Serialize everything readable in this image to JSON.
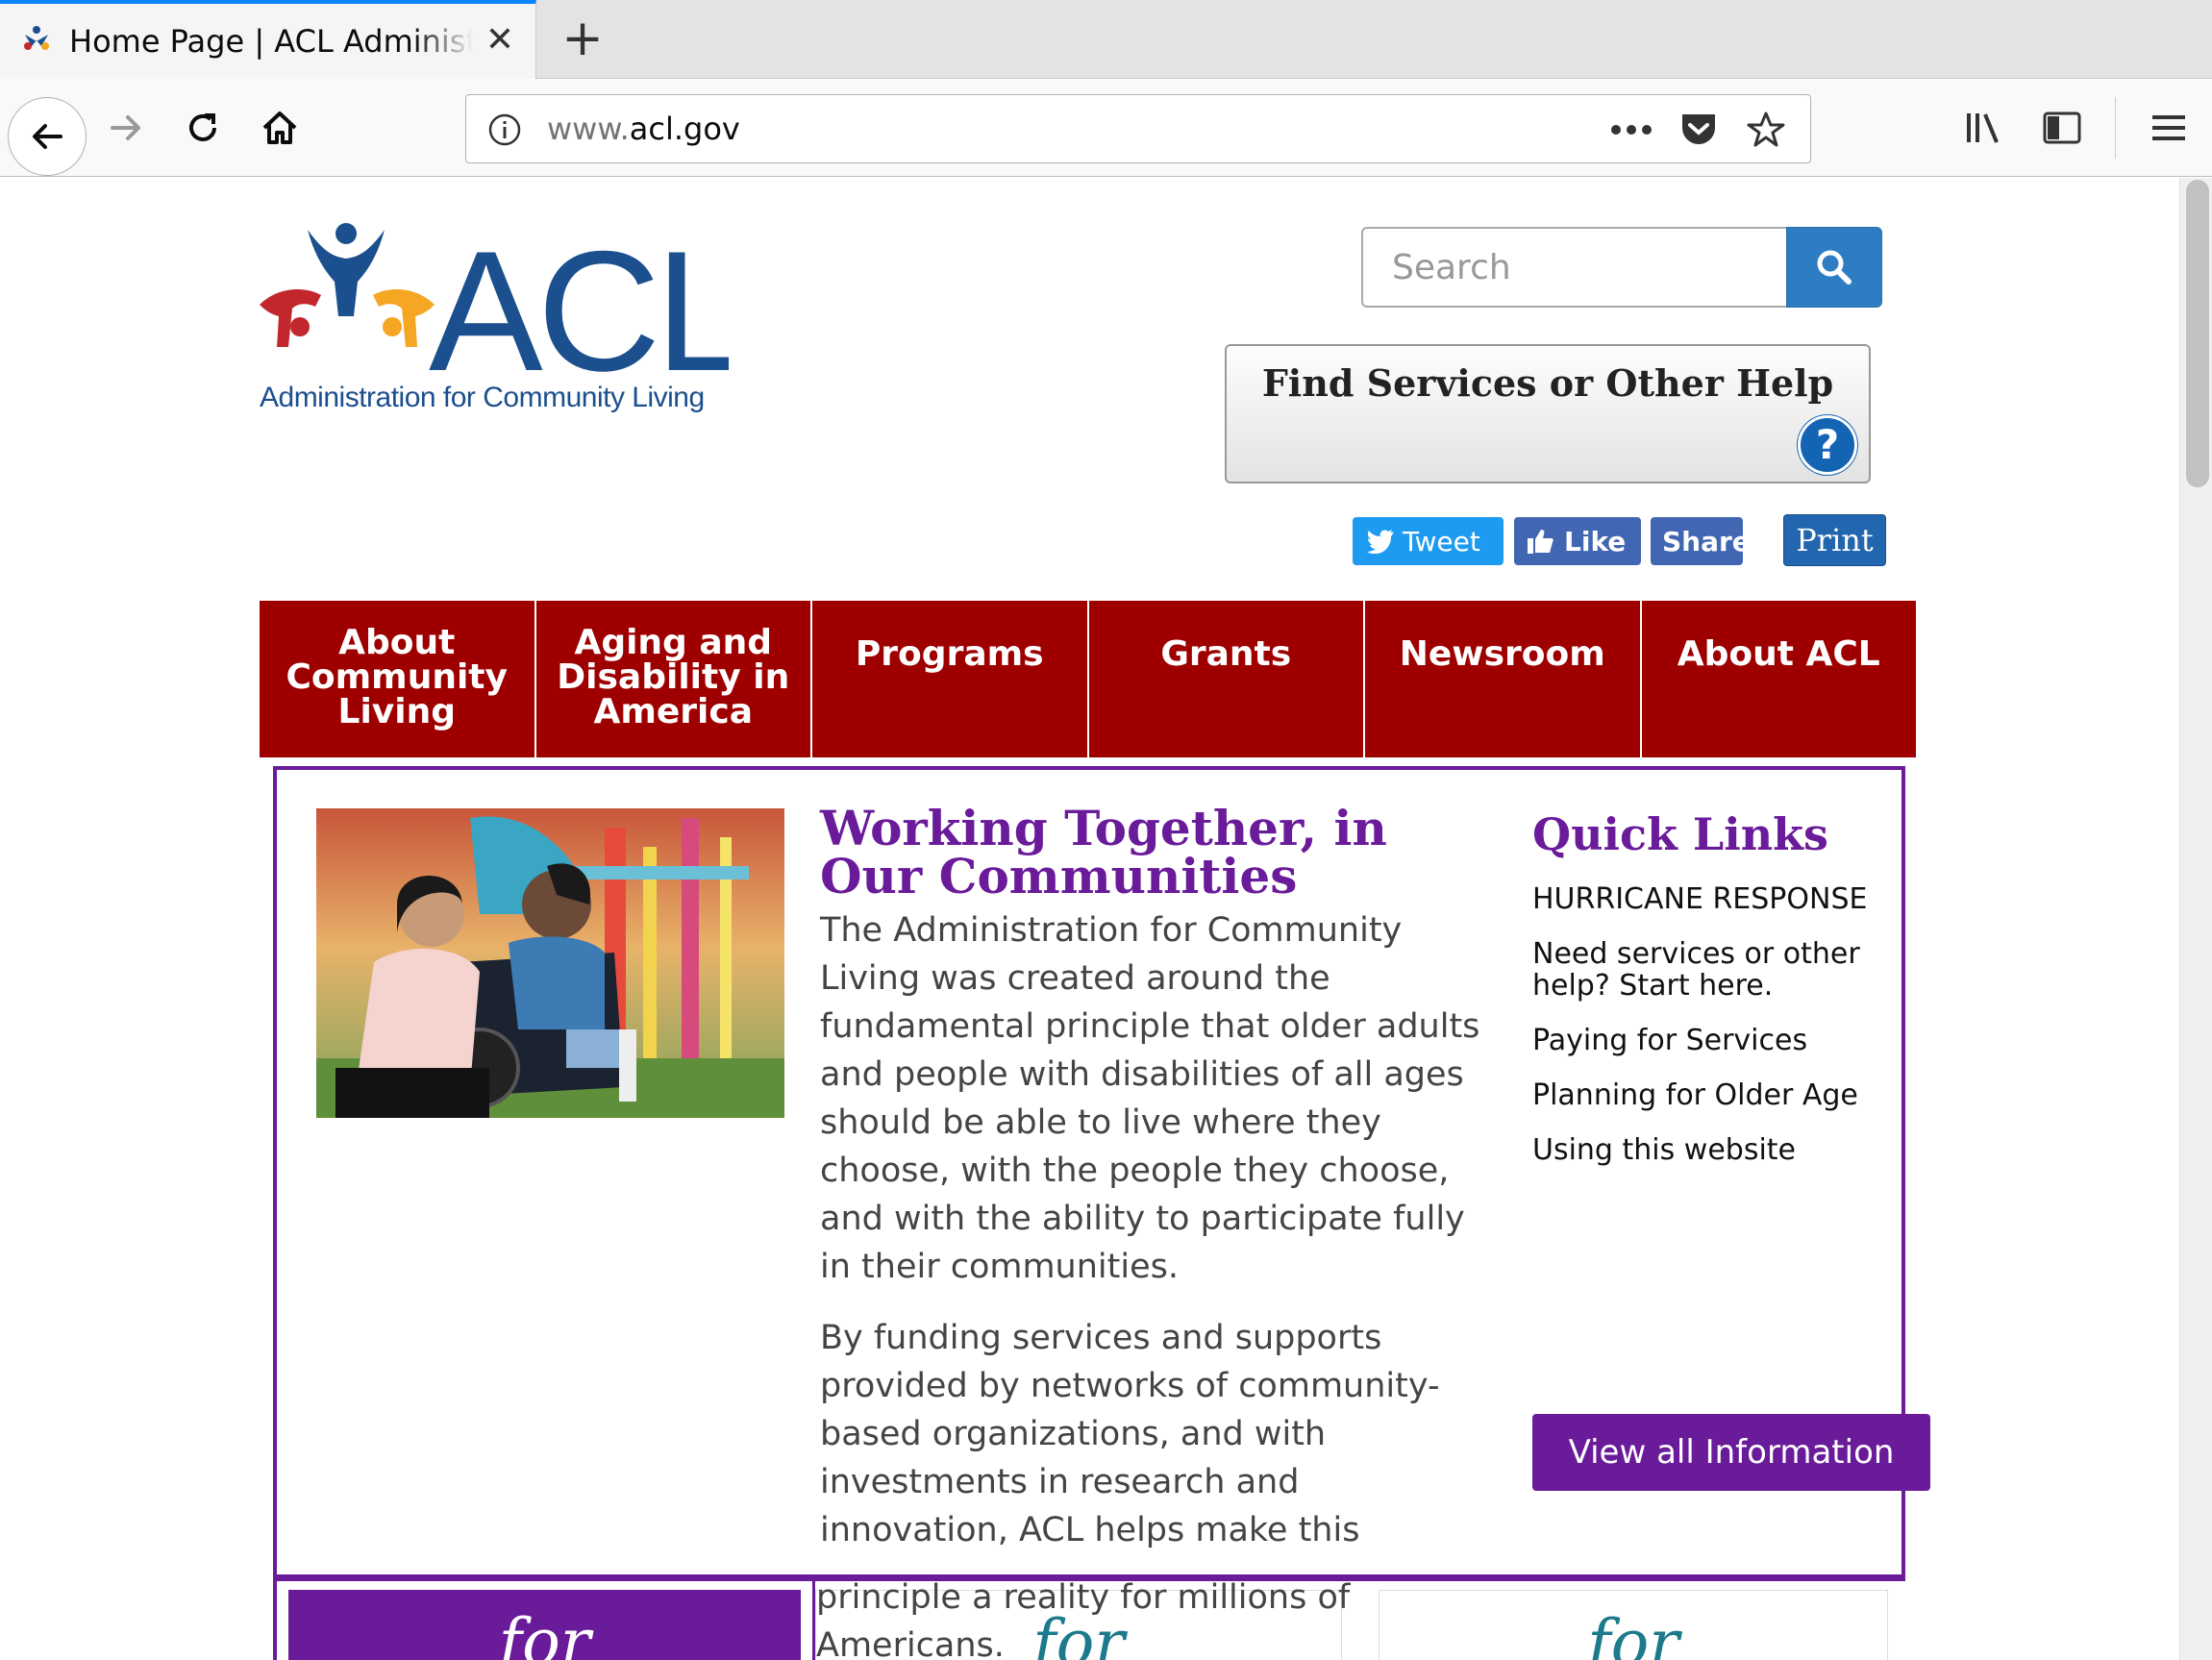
{
  "browser": {
    "tab_title": "Home Page | ACL Administration for Community Living",
    "url_prefix": "www.",
    "url_domain": "acl.gov"
  },
  "header": {
    "logo_text": "ACL",
    "logo_subtitle": "Administration for Community Living",
    "search_placeholder": "Search",
    "find_services_label": "Find Services or Other Help",
    "help_symbol": "?",
    "social": {
      "tweet": "Tweet",
      "like": "Like",
      "share": "Share",
      "print": "Print"
    }
  },
  "nav": {
    "items": [
      {
        "label": "About Community Living"
      },
      {
        "label": "Aging and Disability in America"
      },
      {
        "label": "Programs"
      },
      {
        "label": "Grants"
      },
      {
        "label": "Newsroom"
      },
      {
        "label": "About ACL"
      }
    ]
  },
  "main": {
    "headline": "Working Together, in Our Communities",
    "paragraphs": [
      "The Administration for Community Living was created around the fundamental principle that older adults and people with disabilities of all ages should be able to live where they choose, with the people they choose, and with the ability to participate fully in their communities.",
      "By funding services and supports provided by networks of community-based organizations, and with investments in research and innovation, ACL helps make this"
    ],
    "overflow_text": "principle a reality for millions of Americans."
  },
  "quick_links": {
    "title": "Quick Links",
    "items": [
      "HURRICANE RESPONSE",
      "Need services or other help? Start here.",
      "Paying for Services",
      "Planning for Older Age",
      "Using this website"
    ],
    "view_all": "View all Information"
  },
  "cards": {
    "card1": "for",
    "card2": "for",
    "card3": "for"
  },
  "colors": {
    "nav_red": "#9e0000",
    "accent_purple": "#6a1b9a",
    "search_blue": "#2e7dc4"
  }
}
